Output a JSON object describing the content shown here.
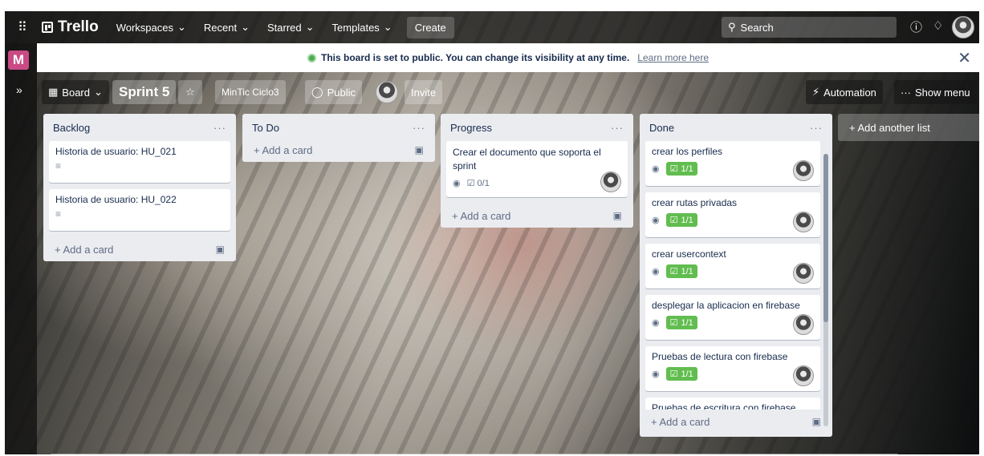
{
  "nav": {
    "brand": "Trello",
    "items": [
      {
        "label": "Workspaces",
        "caret": "⌄"
      },
      {
        "label": "Recent",
        "caret": "⌄"
      },
      {
        "label": "Starred",
        "caret": "⌄"
      },
      {
        "label": "Templates",
        "caret": "⌄"
      }
    ],
    "create": "Create",
    "search_placeholder": "Search"
  },
  "side": {
    "workspace_letter": "M"
  },
  "banner": {
    "message": "This board is set to public. You can change its visibility at any time.",
    "link": "Learn more here"
  },
  "board": {
    "view": "Board",
    "title": "Sprint 5",
    "workspace": "MinTic Ciclo3",
    "visibility": "Public",
    "invite": "Invite",
    "automation": "Automation",
    "show_menu": "Show menu"
  },
  "add_card_label": "+ Add a card",
  "add_list_label": "+ Add another list",
  "lists": [
    {
      "title": "Backlog",
      "cards": [
        {
          "title": "Historia de usuario: HU_021"
        },
        {
          "title": "Historia de usuario: HU_022"
        }
      ]
    },
    {
      "title": "To Do",
      "cards": []
    },
    {
      "title": "Progress",
      "cards": [
        {
          "title": "Crear el documento que soporta el sprint",
          "checklist": "0/1"
        }
      ]
    },
    {
      "title": "Done",
      "cards": [
        {
          "title": "crear los perfiles",
          "checklist": "1/1"
        },
        {
          "title": "crear rutas privadas",
          "checklist": "1/1"
        },
        {
          "title": "crear usercontext",
          "checklist": "1/1"
        },
        {
          "title": "desplegar la aplicacion en firebase",
          "checklist": "1/1"
        },
        {
          "title": "Pruebas de lectura con firebase",
          "checklist": "1/1"
        },
        {
          "title": "Pruebas de escritura con firebase"
        }
      ]
    }
  ],
  "colors": {
    "list_bg": "#ebecf0",
    "complete_green": "#61bd4f",
    "workspace_badge": "#c94a84"
  }
}
